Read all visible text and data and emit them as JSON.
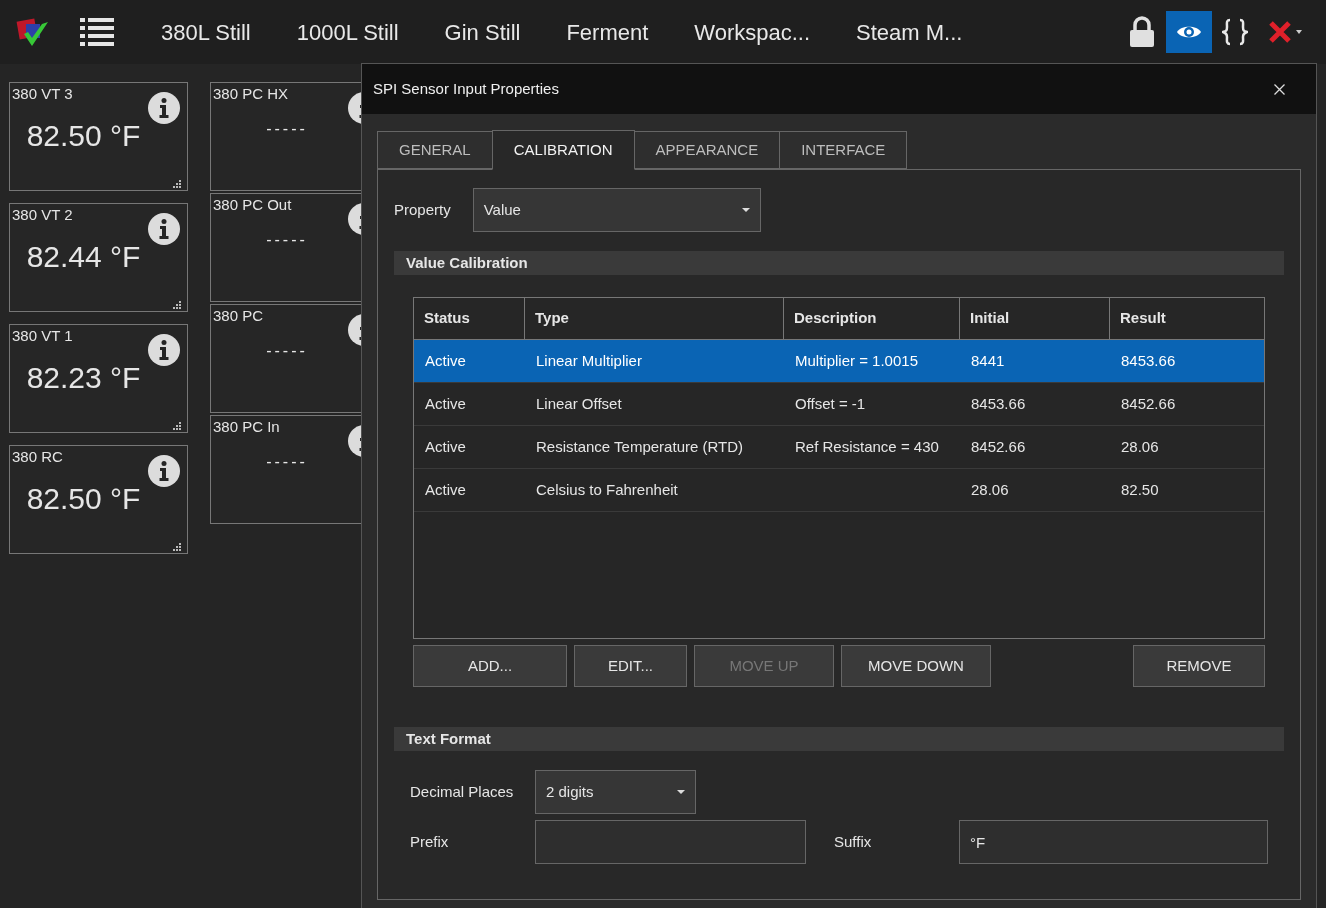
{
  "menu_bar": {
    "tabs": [
      {
        "label": "380L Still"
      },
      {
        "label": "1000L Still"
      },
      {
        "label": "Gin Still"
      },
      {
        "label": "Ferment"
      },
      {
        "label": "Workspac..."
      },
      {
        "label": "Steam M..."
      }
    ],
    "tools": [
      {
        "kind": "lock",
        "selected": false
      },
      {
        "kind": "eye",
        "selected": true
      },
      {
        "kind": "braces",
        "selected": false
      },
      {
        "kind": "close",
        "selected": false
      }
    ]
  },
  "widget_columns": [
    [
      {
        "name": "380 VT 3",
        "value": "82.50 °F"
      },
      {
        "name": "380 VT 2",
        "value": "82.44 °F"
      },
      {
        "name": "380 VT 1",
        "value": "82.23 °F"
      },
      {
        "name": "380 RC",
        "value": "82.50 °F"
      }
    ],
    [
      {
        "name": "380 PC HX",
        "value": "-----"
      },
      {
        "name": "380 PC Out",
        "value": "-----"
      },
      {
        "name": "380 PC",
        "value": "-----"
      },
      {
        "name": "380 PC In",
        "value": "-----"
      }
    ]
  ],
  "dialog": {
    "title": "SPI Sensor Input Properties",
    "tabs": [
      {
        "label": "GENERAL",
        "selected": false
      },
      {
        "label": "CALIBRATION",
        "selected": true
      },
      {
        "label": "APPEARANCE",
        "selected": false
      },
      {
        "label": "INTERFACE",
        "selected": false
      }
    ],
    "property": {
      "label": "Property",
      "value": "Value"
    },
    "value_calibration": {
      "title": "Value Calibration",
      "columns": [
        "Status",
        "Type",
        "Description",
        "Initial",
        "Result"
      ],
      "rows": [
        {
          "cells": [
            "Active",
            "Linear Multiplier",
            "Multiplier = 1.0015",
            "8441",
            "8453.66"
          ],
          "selected": true
        },
        {
          "cells": [
            "Active",
            "Linear Offset",
            "Offset = -1",
            "8453.66",
            "8452.66"
          ],
          "selected": false
        },
        {
          "cells": [
            "Active",
            "Resistance Temperature (RTD)",
            "Ref Resistance = 430",
            "8452.66",
            "28.06"
          ],
          "selected": false
        },
        {
          "cells": [
            "Active",
            "Celsius to Fahrenheit",
            "",
            "28.06",
            "82.50"
          ],
          "selected": false
        }
      ],
      "buttons": [
        {
          "label": "ADD...",
          "disabled": false
        },
        {
          "label": "EDIT...",
          "disabled": false
        },
        {
          "label": "MOVE UP",
          "disabled": true
        },
        {
          "label": "MOVE DOWN",
          "disabled": false
        },
        {
          "label": "REMOVE",
          "disabled": false
        }
      ]
    },
    "text_format": {
      "title": "Text Format",
      "decimal_places": {
        "label": "Decimal Places",
        "value": "2 digits"
      },
      "prefix": {
        "label": "Prefix"
      },
      "suffix": {
        "label": "Suffix",
        "value": "°F"
      }
    }
  }
}
